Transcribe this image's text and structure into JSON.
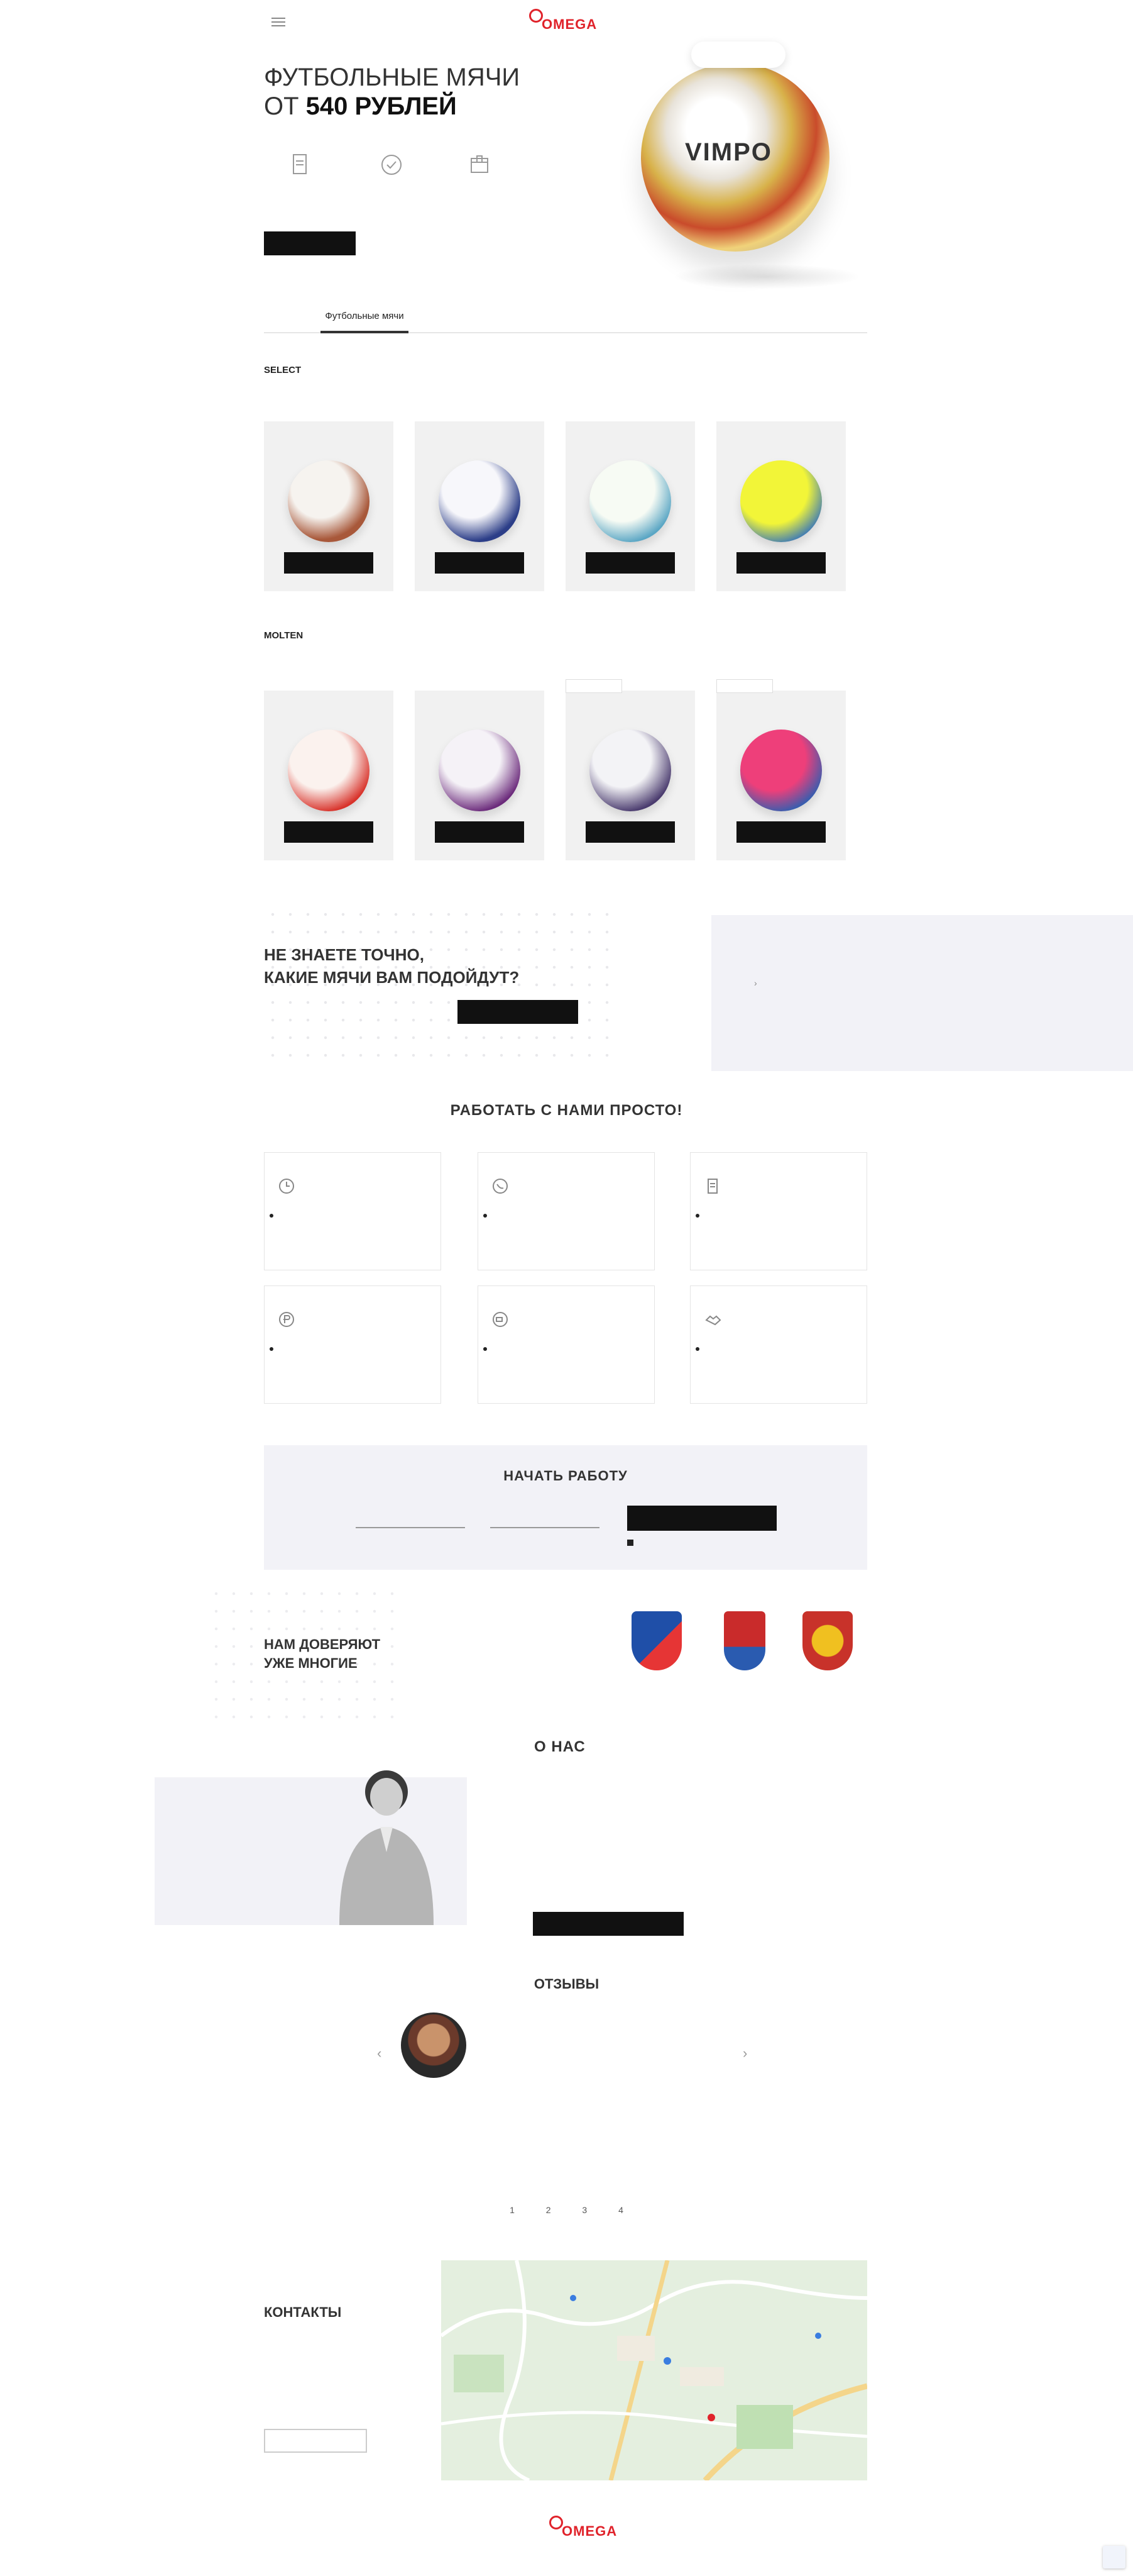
{
  "brand": {
    "logo_text": "OMEGA",
    "accent": "#e0232b"
  },
  "header": {
    "menu_icon": "hamburger-icon",
    "contacts": [
      "",
      ""
    ]
  },
  "hero": {
    "title_line1": "ФУТБОЛЬНЫЕ МЯЧИ",
    "title_prefix": "ОТ ",
    "title_price": "540 РУБЛЕЙ",
    "subtitle": "",
    "features": [
      {
        "icon": "document-icon",
        "text": ""
      },
      {
        "icon": "check-circle-icon",
        "text": ""
      },
      {
        "icon": "box-icon",
        "text": ""
      }
    ],
    "button_label": "",
    "bubble_text": "",
    "ball_brand": "VIMPO"
  },
  "tabs": [
    "Футбольные мячи",
    "",
    ""
  ],
  "sections": [
    {
      "label": "SELECT",
      "text": "",
      "products": [
        {
          "title": "",
          "button": "",
          "tag": "",
          "ball_colors": [
            "#f6f3ef",
            "#a8583a"
          ]
        },
        {
          "title": "",
          "button": "",
          "tag": "",
          "ball_colors": [
            "#f7f7fb",
            "#2c3e88"
          ]
        },
        {
          "title": "",
          "button": "",
          "tag": "",
          "ball_colors": [
            "#f7fbf4",
            "#5aa6c4"
          ]
        },
        {
          "title": "",
          "button": "",
          "tag": "",
          "ball_colors": [
            "#f2f538",
            "#3a78b8"
          ]
        }
      ]
    },
    {
      "label": "MOLTEN",
      "text": "",
      "products": [
        {
          "title": "",
          "button": "",
          "tag": "",
          "ball_colors": [
            "#fbf2ee",
            "#d8322a"
          ]
        },
        {
          "title": "",
          "button": "",
          "tag": "",
          "ball_colors": [
            "#f5f2f7",
            "#6b2a7b"
          ]
        },
        {
          "title": "",
          "button": "",
          "tag": "",
          "ball_colors": [
            "#f3f3f6",
            "#4a3b6e"
          ]
        },
        {
          "title": "",
          "button": "",
          "tag": "",
          "ball_colors": [
            "#ee3f7a",
            "#2b5fb2"
          ]
        }
      ]
    }
  ],
  "choose": {
    "title_line1": "НЕ ЗНАЕТЕ ТОЧНО,",
    "title_line2": "КАКИЕ МЯЧИ ВАМ ПОДОЙДУТ?",
    "subtitle": "",
    "button_label": "",
    "video_label": ""
  },
  "steps": {
    "title": "РАБОТАТЬ С НАМИ ПРОСТО!",
    "items": [
      {
        "icon": "clock-icon",
        "title": "",
        "text": ""
      },
      {
        "icon": "phone-icon",
        "title": "",
        "text": ""
      },
      {
        "icon": "document-icon",
        "title": "",
        "text": ""
      },
      {
        "icon": "ruble-icon",
        "title": "",
        "text": ""
      },
      {
        "icon": "truck-icon",
        "title": "",
        "text": ""
      },
      {
        "icon": "handshake-icon",
        "title": "",
        "text": ""
      }
    ]
  },
  "start": {
    "title": "НАЧАТЬ РАБОТУ",
    "subtitle": "",
    "name_placeholder": "",
    "phone_placeholder": "",
    "button_label": "",
    "agree_text": ""
  },
  "clubs": {
    "title_line1": "НАМ ДОВЕРЯЮТ",
    "title_line2": "УЖЕ МНОГИЕ",
    "items": [
      {
        "name": "",
        "city": "",
        "crest_colors": [
          "#1f4fa8",
          "#e63535"
        ]
      },
      {
        "name": "",
        "city": "",
        "crest_colors": [
          "#c92b2b",
          "#2a5bb0"
        ]
      },
      {
        "name": "",
        "city": "",
        "crest_colors": [
          "#f0c020",
          "#c8322a"
        ]
      }
    ]
  },
  "about": {
    "title": "О НАС",
    "paragraphs": [
      "",
      "",
      ""
    ],
    "button_label": ""
  },
  "reviews": {
    "title": "ОТЗЫВЫ",
    "name": "",
    "text": "",
    "pages": "1 2 3 4"
  },
  "contacts": {
    "title": "КОНТАКТЫ",
    "lines": [
      "",
      "",
      "",
      "",
      "",
      ""
    ],
    "button_label": ""
  },
  "footer": {
    "left": "",
    "right": ""
  }
}
